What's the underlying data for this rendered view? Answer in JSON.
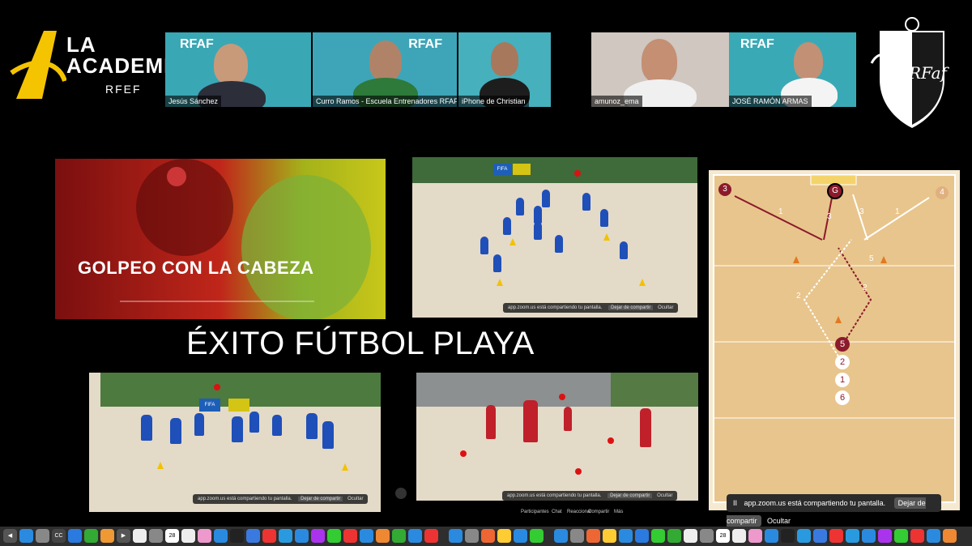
{
  "logo_left": {
    "brand_line1": "LA",
    "brand_line2": "ACADEMIA",
    "sub": "RFEF"
  },
  "participants": [
    {
      "name": "Jesús Sánchez",
      "brand": "RFAF"
    },
    {
      "name": "Curro Ramos - Escuela Entrenadores RFAF",
      "brand": "RFAF"
    },
    {
      "name": "iPhone de Christian",
      "brand": ""
    },
    {
      "name": "amunoz_ema",
      "brand": ""
    },
    {
      "name": "JOSÉ RAMÓN ARMAS",
      "brand": "RFAF"
    }
  ],
  "logo_right": {
    "text": "RFaf"
  },
  "slide_title": "GOLPEO CON LA CABEZA",
  "headline": "ÉXITO FÚTBOL PLAYA",
  "video_banner": {
    "fifa": "FIFA"
  },
  "zoom_share_text_small": "app.zoom.us está compartiendo tu pantalla.",
  "zoom_stop_small": "Dejar de compartir",
  "zoom_hide_small": "Ocultar",
  "zoom_toolbar": [
    "Participantes",
    "Chat",
    "Reaccionar",
    "Compartir",
    "Más"
  ],
  "board": {
    "players": [
      "3",
      "4",
      "5",
      "2",
      "1",
      "6"
    ],
    "goal_label": "G",
    "arrow_labels": [
      "1",
      "3",
      "3",
      "1",
      "5",
      "2",
      "2"
    ]
  },
  "share_bar": {
    "pause": "II",
    "text": "app.zoom.us está compartiendo tu pantalla.",
    "stop": "Dejar de compartir",
    "hide": "Ocultar"
  },
  "dock": {
    "calendar_day": "28",
    "apps": [
      "Finder",
      "Launchpad",
      "Safari",
      "Chrome",
      "Mail",
      "Messages",
      "Photos",
      "Calendar",
      "Music",
      "Telegram",
      "Zoom",
      "App Store"
    ]
  },
  "colors": {
    "board_red": "#8b1a2b",
    "player_blue": "#1f4fb8",
    "player_red": "#c0202a",
    "cone_yellow": "#f2c200"
  }
}
